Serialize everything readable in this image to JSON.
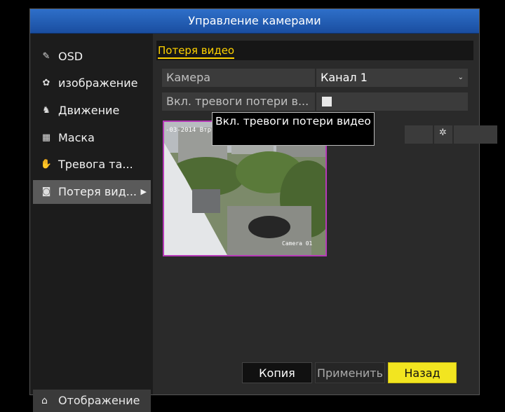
{
  "window": {
    "title": "Управление камерами"
  },
  "sidebar": {
    "items": [
      {
        "label": "OSD",
        "icon": "edit-icon"
      },
      {
        "label": "изображение",
        "icon": "palette-icon"
      },
      {
        "label": "Движение",
        "icon": "running-man-icon"
      },
      {
        "label": "Маска",
        "icon": "mask-icon"
      },
      {
        "label": "Тревога та...",
        "icon": "hand-icon"
      },
      {
        "label": "Потеря вид...",
        "icon": "video-loss-icon",
        "active": true
      }
    ],
    "home_label": "Отображение"
  },
  "content": {
    "section_title": "Потеря видео",
    "camera_label": "Камера",
    "camera_value": "Канал 1",
    "alarm_label": "Вкл. тревоги потери в...",
    "alarm_enabled": false,
    "tooltip": "Вкл. тревоги потери видео",
    "preview_osd": "-03-2014 Втр 10:39:",
    "preview_camera_name": "Camera 01"
  },
  "buttons": {
    "copy": "Копия",
    "apply": "Применить",
    "back": "Назад"
  },
  "colors": {
    "title_bar": "#1f57b0",
    "accent_yellow": "#ffd200",
    "back_button": "#f2e520"
  }
}
